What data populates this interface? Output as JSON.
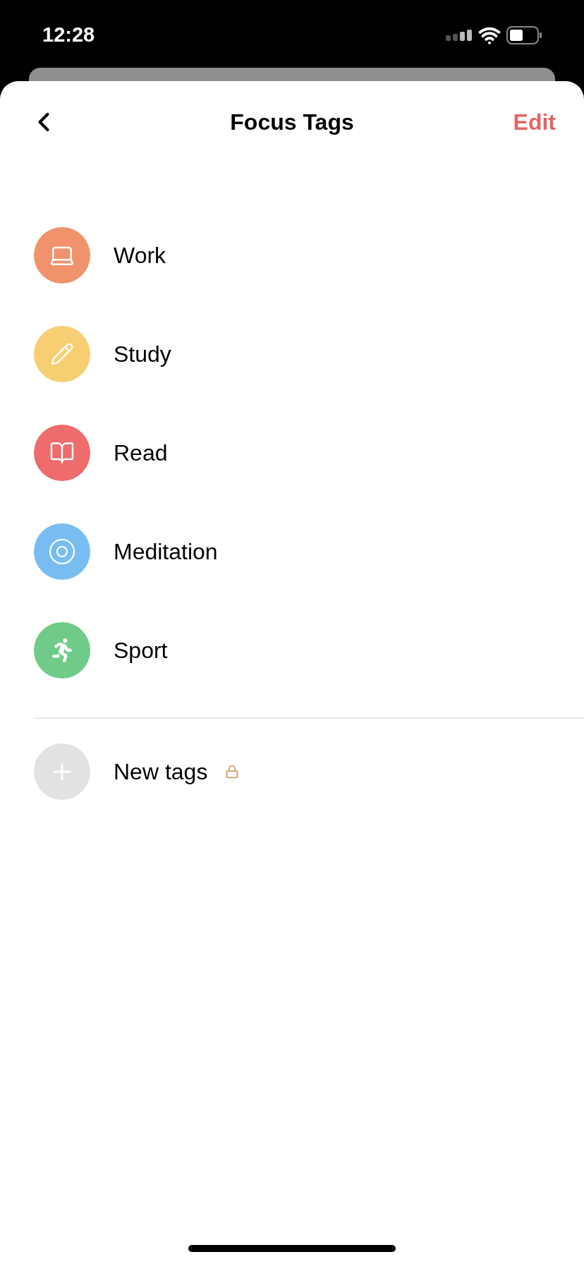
{
  "status_bar": {
    "time": "12:28"
  },
  "header": {
    "title": "Focus Tags",
    "action": "Edit"
  },
  "tags": [
    {
      "label": "Work",
      "kind": "laptop",
      "color": "#f0936c"
    },
    {
      "label": "Study",
      "kind": "pencil",
      "color": "#f7cf72"
    },
    {
      "label": "Read",
      "kind": "book",
      "color": "#ee6c6c"
    },
    {
      "label": "Meditation",
      "kind": "target",
      "color": "#78bdf2"
    },
    {
      "label": "Sport",
      "kind": "runner",
      "color": "#71cb88"
    }
  ],
  "new_tag": {
    "label": "New tags",
    "locked": true
  }
}
